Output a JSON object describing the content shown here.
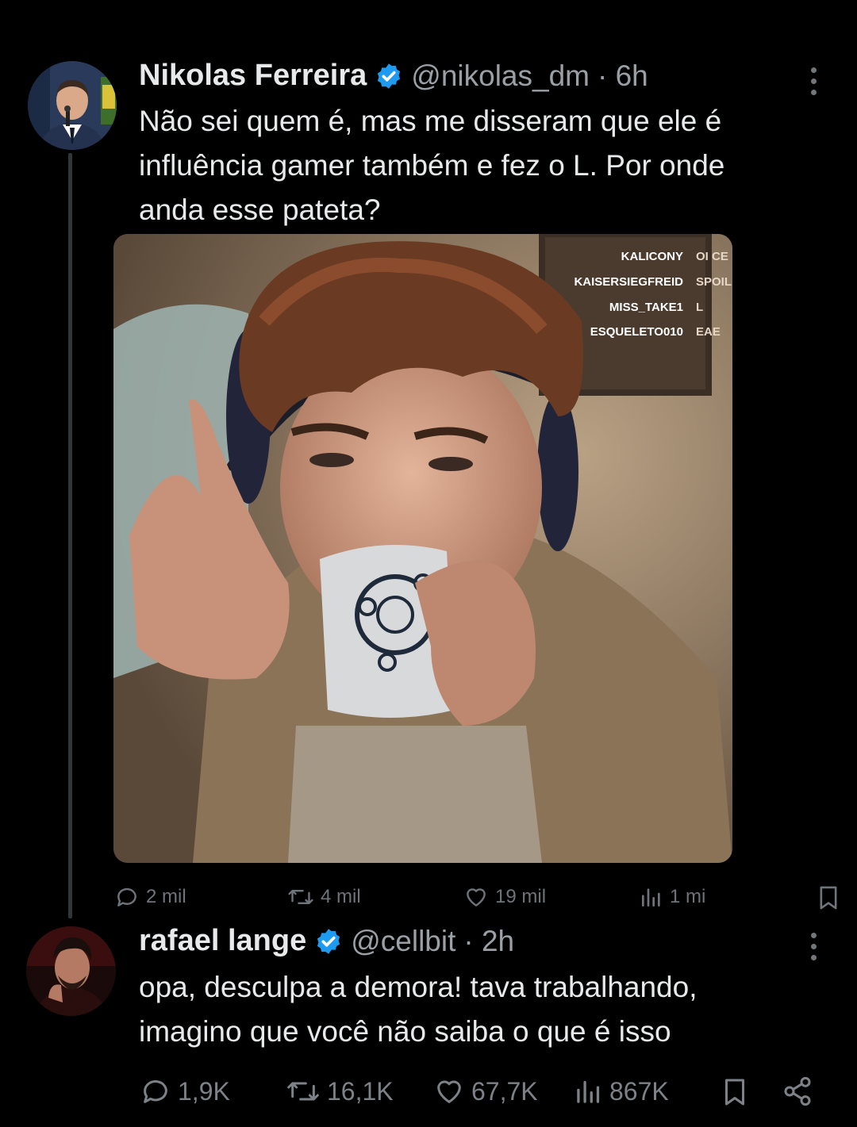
{
  "tweet1": {
    "display_name": "Nikolas Ferreira",
    "handle": "@nikolas_dm",
    "time": "· 6h",
    "text_lines": [
      "Não sei quem é, mas me disseram que ele é",
      "influência gamer também e fez o L. Por onde",
      "anda esse pateta?"
    ],
    "chat": [
      {
        "user": "KALICONY",
        "msg": "OI CE"
      },
      {
        "user": "KAISERSIEGFREID",
        "msg": "SPOIL"
      },
      {
        "user": "MISS_TAKE1",
        "msg": "L"
      },
      {
        "user": "ESQUELETO010",
        "msg": "EAE"
      }
    ],
    "stats": {
      "replies": "2 mil",
      "reposts": "4 mil",
      "likes": "19 mil",
      "views": "1 mi"
    }
  },
  "tweet2": {
    "display_name": "rafael lange",
    "handle": "@cellbit",
    "time": "· 2h",
    "text_lines": [
      "opa, desculpa a demora! tava trabalhando,",
      "imagino que você não saiba o que é isso"
    ],
    "stats": {
      "replies": "1,9K",
      "reposts": "16,1K",
      "likes": "67,7K",
      "views": "867K"
    }
  },
  "colors": {
    "background": "#000000",
    "text": "#e7e9ea",
    "secondary": "#71767b",
    "verified": "#1d9bf0"
  },
  "icons": [
    "verified-badge-icon",
    "more-icon",
    "reply-icon",
    "repost-icon",
    "like-icon",
    "views-icon",
    "bookmark-icon",
    "share-icon"
  ]
}
